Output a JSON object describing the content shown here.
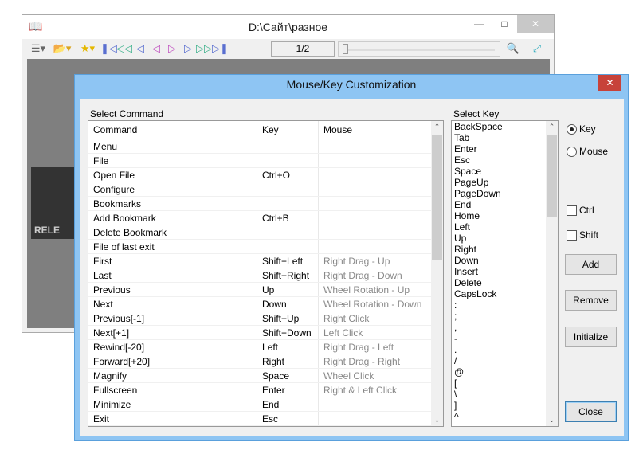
{
  "main_window": {
    "title": "D:\\Сайт\\разное",
    "page": "1/2",
    "logo_text": "RELE",
    "slider_fraction": 0.0
  },
  "dialog": {
    "title": "Mouse/Key Customization",
    "select_command_label": "Select Command",
    "select_key_label": "Select Key",
    "columns": [
      "Command",
      "Key",
      "Mouse"
    ],
    "rows": [
      [
        "Menu",
        "",
        ""
      ],
      [
        "File",
        "",
        ""
      ],
      [
        "Open File",
        "Ctrl+O",
        ""
      ],
      [
        "Configure",
        "",
        ""
      ],
      [
        "Bookmarks",
        "",
        ""
      ],
      [
        "Add Bookmark",
        "Ctrl+B",
        ""
      ],
      [
        "Delete Bookmark",
        "",
        ""
      ],
      [
        "File of last exit",
        "",
        ""
      ],
      [
        "First",
        "Shift+Left",
        "Right Drag - Up"
      ],
      [
        "Last",
        "Shift+Right",
        "Right Drag - Down"
      ],
      [
        "Previous",
        "Up",
        "Wheel Rotation - Up"
      ],
      [
        "Next",
        "Down",
        "Wheel Rotation - Down"
      ],
      [
        "Previous[-1]",
        "Shift+Up",
        "Right Click"
      ],
      [
        "Next[+1]",
        "Shift+Down",
        "Left Click"
      ],
      [
        "Rewind[-20]",
        "Left",
        "Right Drag - Left"
      ],
      [
        "Forward[+20]",
        "Right",
        "Right Drag - Right"
      ],
      [
        "Magnify",
        "Space",
        "Wheel Click"
      ],
      [
        "Fullscreen",
        "Enter",
        "Right & Left Click"
      ],
      [
        "Minimize",
        "End",
        ""
      ],
      [
        "Exit",
        "Esc",
        ""
      ]
    ],
    "keys": [
      "BackSpace",
      "Tab",
      "Enter",
      "Esc",
      "Space",
      "PageUp",
      "PageDown",
      "End",
      "Home",
      "Left",
      "Up",
      "Right",
      "Down",
      "Insert",
      "Delete",
      "CapsLock",
      ":",
      ";",
      ",",
      "-",
      ".",
      "/",
      "@",
      "[",
      "\\",
      "]",
      "^"
    ],
    "radio_key": "Key",
    "radio_mouse": "Mouse",
    "ctrl": "Ctrl",
    "shift": "Shift",
    "add": "Add",
    "remove": "Remove",
    "initialize": "Initialize",
    "close": "Close"
  }
}
